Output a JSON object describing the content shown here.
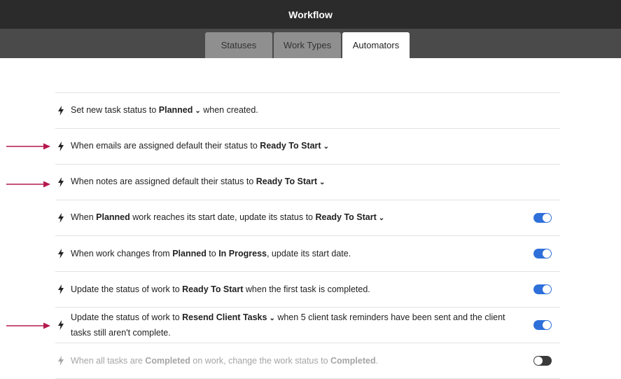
{
  "app": {
    "title": "Workflow"
  },
  "tabs": [
    {
      "label": "Statuses"
    },
    {
      "label": "Work Types"
    },
    {
      "label": "Automators"
    }
  ],
  "active_tab": "Automators",
  "colors": {
    "accent": "#2f6fd9",
    "annotation_arrow": "#b5194f",
    "header": "#2b2b2b"
  },
  "rules": [
    {
      "pre": "Set new task status to ",
      "b1": "Planned",
      "post": " when created."
    },
    {
      "pre": "When emails are assigned default their status to ",
      "b1": "Ready To Start"
    },
    {
      "pre": "When notes are assigned default their status to ",
      "b1": "Ready To Start"
    },
    {
      "pre": "When ",
      "b1": "Planned",
      "mid": " work reaches its start date, update its status to ",
      "b2": "Ready To Start",
      "toggle": "on"
    },
    {
      "pre": "When work changes from ",
      "b1": "Planned",
      "mid": " to ",
      "b2": "In Progress",
      "post": ", update its start date.",
      "toggle": "on"
    },
    {
      "pre": "Update the status of work to ",
      "b1": "Ready To Start",
      "post": " when the first task is completed.",
      "toggle": "on"
    },
    {
      "pre": "Update the status of work to ",
      "b1": "Resend Client Tasks",
      "post": " when 5 client task reminders have been sent and the client tasks still aren't complete.",
      "toggle": "on"
    },
    {
      "pre": "When all tasks are ",
      "b1": "Completed",
      "mid": " on work, change the work status to ",
      "b2": "Completed",
      "post": ".",
      "toggle": "off"
    }
  ]
}
